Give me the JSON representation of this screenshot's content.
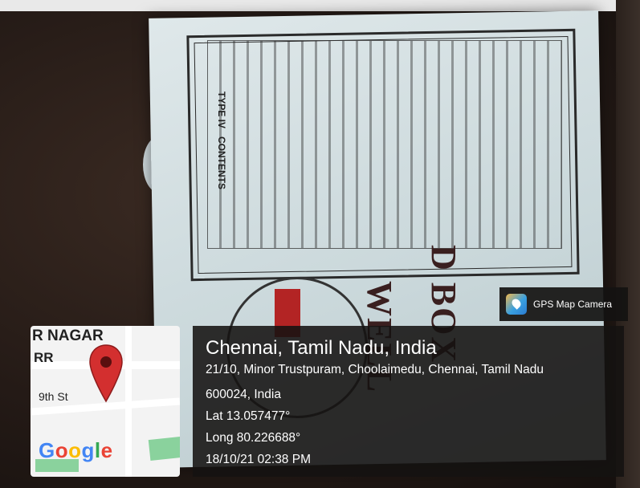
{
  "map": {
    "area_label": "NAGAR",
    "area_label_prefix": "R",
    "street_partial": "RR",
    "street": "9th St",
    "logo": "Google",
    "pin_icon": "map-pin-icon",
    "pin_color": "#d32f2f"
  },
  "location": {
    "place": "Chennai, Tamil Nadu, India",
    "address_line1": "21/10, Minor Trustpuram, Choolaimedu, Chennai, Tamil Nadu",
    "address_line2": "600024, India",
    "lat": "Lat 13.057477°",
    "long": "Long 80.226688°",
    "timestamp": "18/10/21 02:38 PM"
  },
  "badge": {
    "app_name": "GPS Map Camera",
    "icon": "gps-map-camera-icon"
  },
  "photo": {
    "box_type": "TYPE IV",
    "box_heading": "CONTENTS",
    "brand_partial": "WELL",
    "brand_partial2": "D BOX"
  }
}
